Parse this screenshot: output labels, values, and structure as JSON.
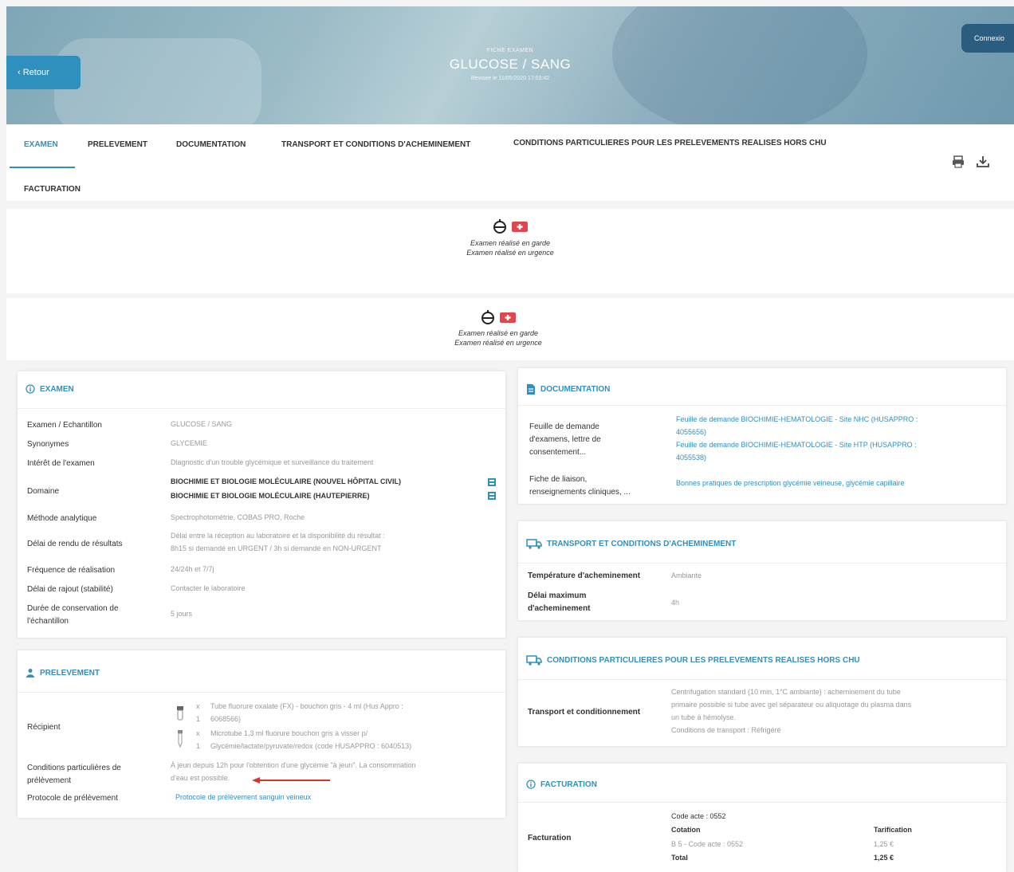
{
  "header": {
    "back_label": "‹ Retour",
    "connect_label": "Connexio",
    "small_label": "FICHE EXAMEN",
    "title": "GLUCOSE / SANG",
    "date": "Révisée le 11/05/2020 17:03:42"
  },
  "tabs": [
    {
      "label": "EXAMEN"
    },
    {
      "label": "PRELEVEMENT"
    },
    {
      "label": "DOCUMENTATION"
    },
    {
      "label": "TRANSPORT ET CONDITIONS D'ACHEMINEMENT"
    },
    {
      "label": "CONDITIONS PARTICULIERES POUR LES PRELEVEMENTS REALISES HORS CHU"
    },
    {
      "label": "FACTURATION"
    }
  ],
  "badges": {
    "line1": "Examen réalisé en garde",
    "line2": "Examen réalisé en urgence"
  },
  "examen": {
    "title": "EXAMEN",
    "rows": [
      {
        "label": "Examen / Echantillon",
        "value": "GLUCOSE / SANG"
      },
      {
        "label": "Synonymes",
        "value": "GLYCEMIE"
      },
      {
        "label": "Intérêt de l'examen",
        "value": "Diagnostic d'un trouble glycémique et surveillance du traitement"
      },
      {
        "label": "Domaine",
        "value1": "BIOCHIMIE ET BIOLOGIE MOLÉCULAIRE (NOUVEL HÔPITAL CIVIL)",
        "value2": "BIOCHIMIE ET BIOLOGIE MOLÉCULAIRE (HAUTEPIERRE)"
      },
      {
        "label": "Méthode analytique",
        "value": "Spectrophotométrie, COBAS PRO, Roche"
      },
      {
        "label": "Délai de rendu de résultats",
        "value1": "Délai entre la réception au laboratoire et la disponibilité du résultat :",
        "value2": "8h15 si demandé en URGENT / 3h si demandé en NON-URGENT"
      },
      {
        "label": "Fréquence de réalisation",
        "value": "24/24h et 7/7j"
      },
      {
        "label": "Délai de rajout (stabilité)",
        "value": "Contacter le laboratoire"
      },
      {
        "label1": "Durée de conservation de",
        "label2": "l'échantillon",
        "value": "5 jours"
      }
    ]
  },
  "prelevement": {
    "title": "PRELEVEMENT",
    "recipient_label": "Récipient",
    "recipient_1_qty": "x",
    "recipient_1_qty2": "1",
    "recipient_1a": "Tube fluorure oxalate (FX) - bouchon gris - 4 ml (Hus Appro :",
    "recipient_1b": "6068566)",
    "recipient_2_qty": "x",
    "recipient_2_qty2": "1",
    "recipient_2a": "Microtube 1,3 ml fluorure bouchon gris à visser p/",
    "recipient_2b": "Glycémie/lactate/pyruvate/redox (code HUSAPPRO : 6040513)",
    "cond_label1": "Conditions particulières de",
    "cond_label2": "prélèvement",
    "cond_value1": "À jeun depuis 12h pour l'obtention d'une glycémie \"à jeun\". La consommation",
    "cond_value2": "d'eau est possible.",
    "protocol_label": "Protocole de prélèvement",
    "protocol_value": "Protocole de prélèvement sanguin veineux"
  },
  "documentation": {
    "title": "DOCUMENTATION",
    "row1_label1": "Feuille de demande",
    "row1_label2": "d'examens, lettre de",
    "row1_label3": "consentement...",
    "row1_link1a": "Feuille de demande BIOCHIMIE-HEMATOLOGIE - Site NHC (HUSAPPRO :",
    "row1_link1b": "4055656)",
    "row1_link2a": "Feuille de demande BIOCHIMIE-HEMATOLOGIE - Site HTP (HUSAPPRO :",
    "row1_link2b": "4055538)",
    "row2_label1": "Fiche de liaison,",
    "row2_label2": "renseignements cliniques, ...",
    "row2_link": "Bonnes pratiques de prescription glycémie veineuse, glycémie capillaire"
  },
  "transport": {
    "title": "TRANSPORT ET CONDITIONS D'ACHEMINEMENT",
    "temp_label": "Température d'acheminement",
    "temp_value": "Ambiante",
    "delay_label1": "Délai maximum",
    "delay_label2": "d'acheminement",
    "delay_value": "4h"
  },
  "conditions": {
    "title": "CONDITIONS PARTICULIERES POUR LES PRELEVEMENTS REALISES HORS CHU",
    "label": "Transport et conditionnement",
    "value1": "Centrifugation standard (10 min, 1°C ambiante) : acheminement du tube",
    "value2": "primaire possible si tube avec gel séparateur ou aliquotage du plasma dans",
    "value3": "un tube à hémolyse.",
    "value4": "Conditions de transport : Réfrigéré"
  },
  "facturation": {
    "title": "FACTURATION",
    "label": "Facturation",
    "code": "Code acte : 0552",
    "cotation_label": "Cotation",
    "cotation_value": "B 5 - Code acte : 0552",
    "total_label": "Total",
    "tarif_label": "Tarification",
    "tarif_value": "1,25 €",
    "total_value": "1,25 €"
  },
  "colors": {
    "accent": "#2f8fbd",
    "badge_red": "#e0464d"
  }
}
